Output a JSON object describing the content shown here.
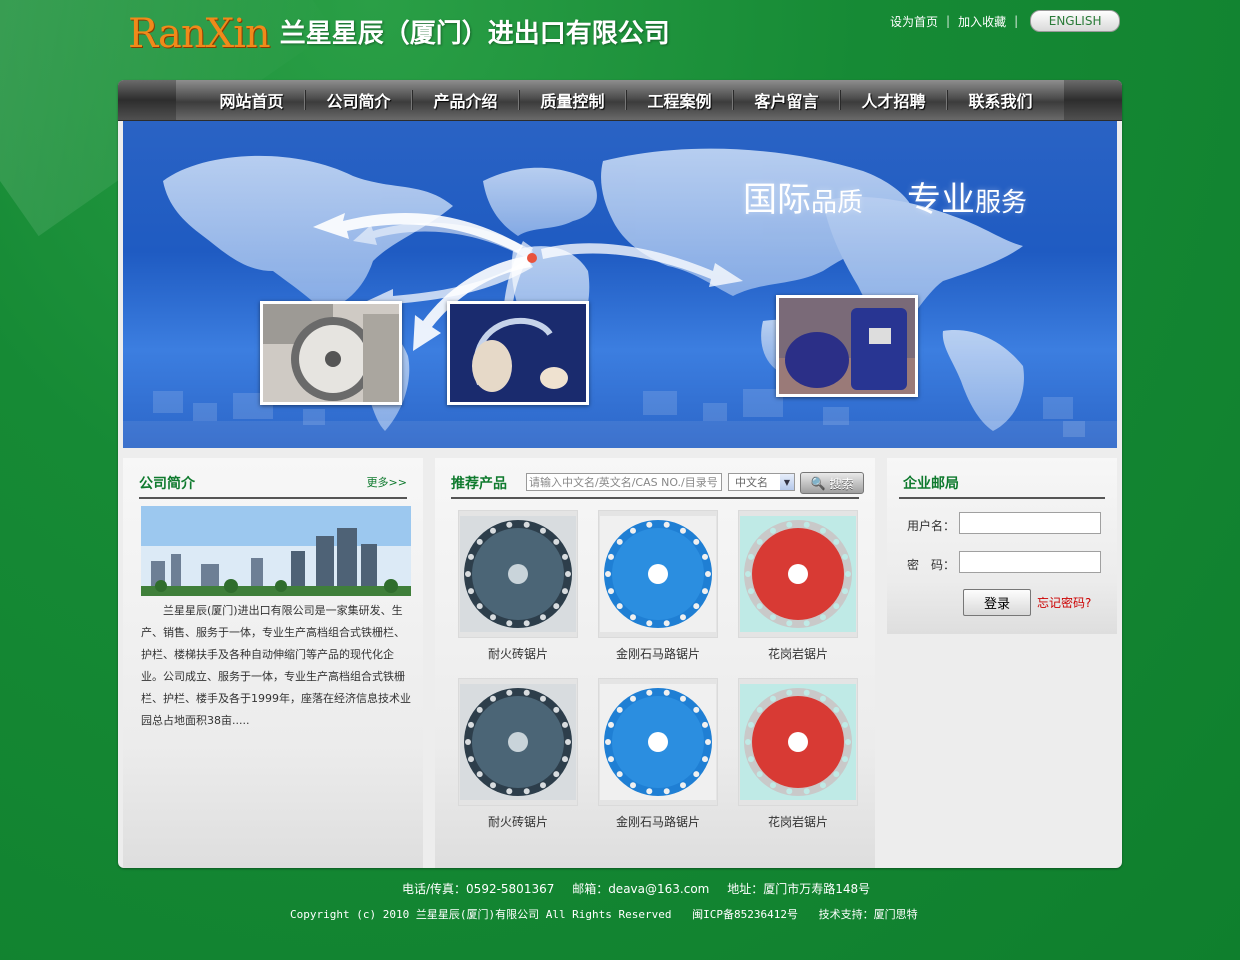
{
  "header": {
    "logo_mark": "RanXin",
    "company_name": "兰星星辰（厦门）进出口有限公司",
    "links": [
      "设为首页",
      "加入收藏"
    ],
    "english_label": "ENGLISH"
  },
  "nav": {
    "items": [
      "网站首页",
      "公司简介",
      "产品介绍",
      "质量控制",
      "工程案例",
      "客户留言",
      "人才招聘",
      "联系我们"
    ]
  },
  "banner": {
    "slogan_big_1": "国际",
    "slogan_small_1": "品质",
    "slogan_big_2": "专业",
    "slogan_small_2": "服务"
  },
  "about": {
    "title": "公司简介",
    "more": "更多>>",
    "text": "兰星星辰(厦门)进出口有限公司是一家集研发、生产、销售、服务于一体，专业生产高档组合式铁栅栏、护栏、楼梯扶手及各种自动伸缩门等产品的现代化企业。公司成立、服务于一体，专业生产高档组合式铁栅栏、护栏、楼手及各于1999年，座落在经济信息技术业园总占地面积38亩....."
  },
  "products": {
    "title": "推荐产品",
    "search_placeholder": "请输入中文名/英文名/CAS NO./目录号",
    "select_value": "中文名",
    "search_button": "搜索",
    "items": [
      {
        "label": "耐火砖锯片",
        "style": "dark"
      },
      {
        "label": "金刚石马路锯片",
        "style": "blue"
      },
      {
        "label": "花岗岩锯片",
        "style": "red"
      },
      {
        "label": "耐火砖锯片",
        "style": "dark"
      },
      {
        "label": "金刚石马路锯片",
        "style": "blue"
      },
      {
        "label": "花岗岩锯片",
        "style": "red"
      }
    ]
  },
  "mail": {
    "title": "企业邮局",
    "username_label": "用户名：",
    "password_label": "密　码：",
    "login_button": "登录",
    "forgot": "忘记密码?"
  },
  "footer": {
    "phone": "电话/传真：0592-5801367",
    "email": "邮箱：deava@163.com",
    "address": "地址：厦门市万寿路148号",
    "copyright": "Copyright (c) 2010 兰星星辰(厦门)有限公司  All Rights Reserved",
    "icp": "闽ICP备85236412号",
    "support": "技术支持：厦门思特"
  },
  "colors": {
    "page_bg": "#168a35",
    "accent_green": "#0f7a2e",
    "logo_orange": "#f08a1a",
    "banner_blue": "#2a63c4",
    "forgot_red": "#cc0000"
  }
}
